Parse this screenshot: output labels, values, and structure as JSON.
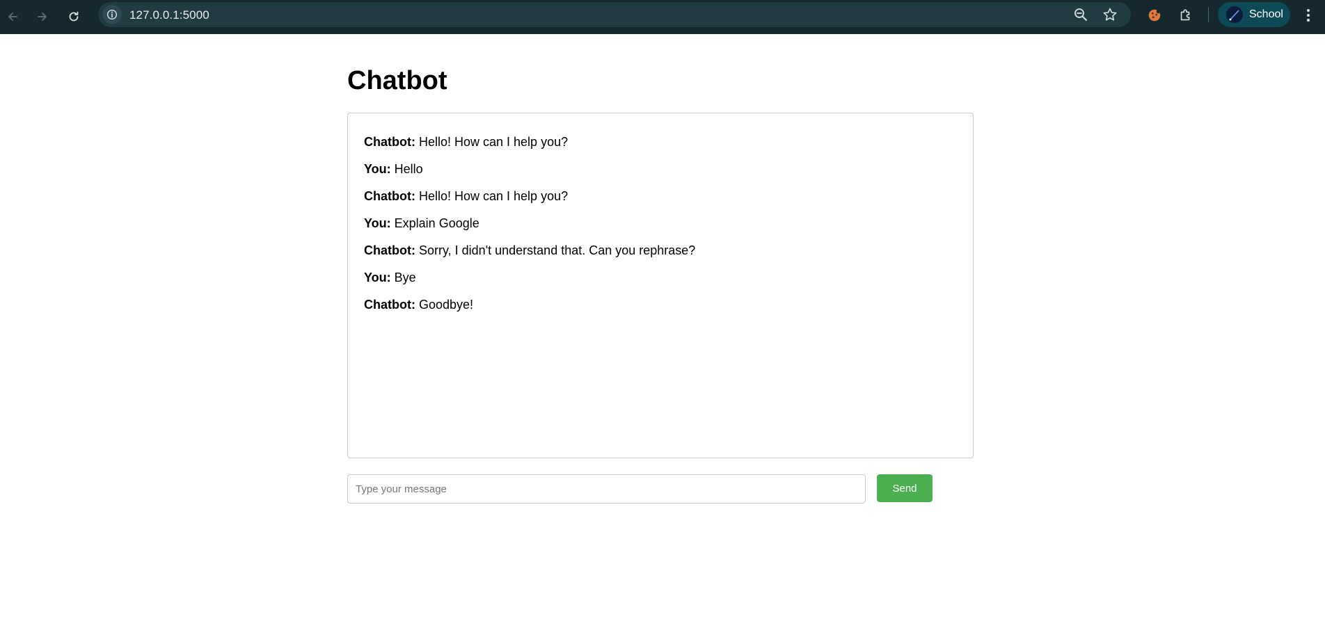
{
  "browser": {
    "url": "127.0.0.1:5000",
    "profile_name": "School",
    "icons": [
      "back-arrow-icon",
      "forward-arrow-icon",
      "reload-icon",
      "site-info-icon",
      "zoom-out-icon",
      "bookmark-star-icon",
      "cookie-extension-icon",
      "extensions-puzzle-icon",
      "menu-kebab-icon"
    ]
  },
  "page": {
    "title": "Chatbot"
  },
  "chat": {
    "messages": [
      {
        "sender": "Chatbot:",
        "text": " Hello! How can I help you?"
      },
      {
        "sender": "You:",
        "text": " Hello"
      },
      {
        "sender": "Chatbot:",
        "text": " Hello! How can I help you?"
      },
      {
        "sender": "You:",
        "text": " Explain Google"
      },
      {
        "sender": "Chatbot:",
        "text": " Sorry, I didn't understand that. Can you rephrase?"
      },
      {
        "sender": "You:",
        "text": " Bye"
      },
      {
        "sender": "Chatbot:",
        "text": " Goodbye!"
      }
    ]
  },
  "composer": {
    "placeholder": "Type your message",
    "value": "",
    "send_label": "Send"
  },
  "colors": {
    "chrome_bg": "#15282e",
    "omnibox_bg": "#213b42",
    "send_button": "#4caf50",
    "profile_chip": "#0d4a56"
  }
}
